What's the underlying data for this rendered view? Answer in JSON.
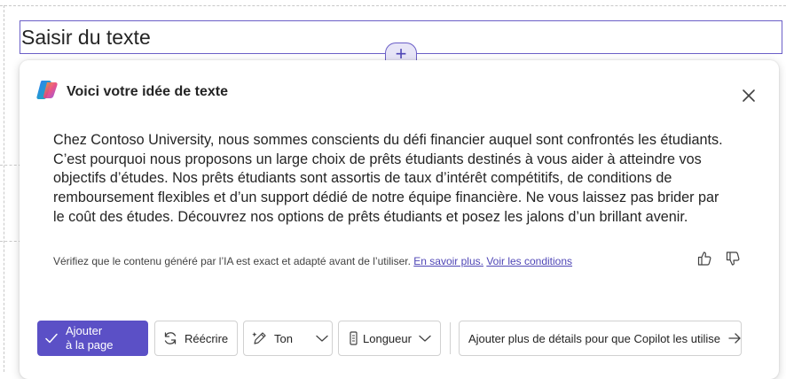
{
  "editor": {
    "text_placeholder": "Saisir du texte",
    "add_section_symbol": "+"
  },
  "copilot_panel": {
    "title": "Voici votre idée de texte",
    "generated_text": "Chez Contoso University, nous sommes conscients du défi financier auquel sont confrontés les étudiants. C’est pourquoi nous proposons un large choix de prêts étudiants destinés à vous aider à atteindre vos objectifs d’études. Nos prêts étudiants sont assortis de taux d’intérêt compétitifs, de conditions de remboursement flexibles et d’un support dédié de notre équipe financière. Ne vous laissez pas brider par le coût des études. Découvrez nos options de prêts étudiants et posez les jalons d’un brillant avenir.",
    "disclaimer": "Vérifiez que le contenu généré par l’IA est exact et adapté avant de l’utiliser.",
    "learn_more_link": "En savoir plus.",
    "terms_link": "Voir les conditions",
    "actions": {
      "add_to_page_line1": "Ajouter",
      "add_to_page_line2": "à la page",
      "rewrite": "Réécrire",
      "tone": "Ton",
      "length": "Longueur",
      "more_details": "Ajouter plus de détails pour que Copilot les utilise"
    },
    "icons": {
      "logo": "copilot-logo-icon",
      "close": "close-icon",
      "thumbs_up": "thumbs-up-icon",
      "thumbs_down": "thumbs-down-icon",
      "check": "checkmark-icon",
      "rewrite": "refresh-icon",
      "tone": "sparkle-pen-icon",
      "length": "length-icon",
      "chevron": "chevron-down-icon",
      "arrow": "arrow-right-icon"
    },
    "colors": {
      "accent": "#5b50c6",
      "link": "#4f46b6",
      "border_focus": "#6b5fc7"
    }
  }
}
